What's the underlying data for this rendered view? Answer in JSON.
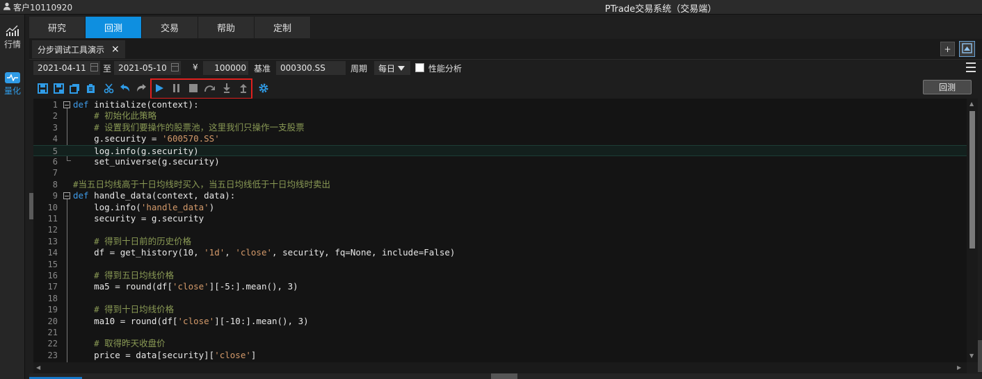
{
  "titlebar": {
    "user": "客户10110920",
    "title": "PTrade交易系统（交易端）"
  },
  "sidebar": {
    "items": [
      {
        "label": "行情",
        "icon": "market-chart-icon"
      },
      {
        "label": "量化",
        "icon": "quant-pulse-icon"
      }
    ]
  },
  "main_tabs": [
    "研究",
    "回测",
    "交易",
    "帮助",
    "定制"
  ],
  "active_main_tab": "回测",
  "file_tab": {
    "label": "分步调试工具演示",
    "close": "×"
  },
  "params": {
    "start_date": "2021-04-11",
    "to_label": "至",
    "end_date": "2021-05-10",
    "currency": "¥",
    "capital": "100000",
    "benchmark_label": "基准",
    "benchmark": "000300.SS",
    "period_label": "周期",
    "period": "每日",
    "perf_label": "性能分析"
  },
  "toolbar": {
    "backtest_label": "回测",
    "plus_label": "+"
  },
  "code_lines": [
    {
      "num": "1",
      "parts": [
        [
          "kw",
          "def"
        ],
        [
          "",
          "initialize(context):"
        ]
      ]
    },
    {
      "num": "2",
      "parts": [
        [
          "",
          "    "
        ],
        [
          "cm",
          "# 初始化此策略"
        ]
      ]
    },
    {
      "num": "3",
      "parts": [
        [
          "",
          "    "
        ],
        [
          "cm",
          "# 设置我们要操作的股票池，这里我们只操作一支股票"
        ]
      ]
    },
    {
      "num": "4",
      "parts": [
        [
          "",
          "    g.security = "
        ],
        [
          "st",
          "'600570.SS'"
        ]
      ]
    },
    {
      "num": "5",
      "parts": [
        [
          "",
          "    log.info(g.security)"
        ]
      ]
    },
    {
      "num": "6",
      "parts": [
        [
          "",
          "    set_universe(g.security)"
        ]
      ]
    },
    {
      "num": "7",
      "parts": []
    },
    {
      "num": "8",
      "parts": [
        [
          "cm",
          "#当五日均线高于十日均线时买入，当五日均线低于十日均线时卖出"
        ]
      ]
    },
    {
      "num": "9",
      "parts": [
        [
          "kw",
          "def"
        ],
        [
          "",
          "handle_data(context, data):"
        ]
      ]
    },
    {
      "num": "10",
      "parts": [
        [
          "",
          "    log.info("
        ],
        [
          "st",
          "'handle_data'"
        ],
        [
          "",
          ")"
        ]
      ]
    },
    {
      "num": "11",
      "parts": [
        [
          "",
          "    security = g.security"
        ]
      ]
    },
    {
      "num": "12",
      "parts": []
    },
    {
      "num": "13",
      "parts": [
        [
          "",
          "    "
        ],
        [
          "cm",
          "# 得到十日前的历史价格"
        ]
      ]
    },
    {
      "num": "14",
      "parts": [
        [
          "",
          "    df = get_history(10, "
        ],
        [
          "st",
          "'1d'"
        ],
        [
          "",
          ", "
        ],
        [
          "st",
          "'close'"
        ],
        [
          "",
          ", security, fq=None, include=False)"
        ]
      ]
    },
    {
      "num": "15",
      "parts": []
    },
    {
      "num": "16",
      "parts": [
        [
          "",
          "    "
        ],
        [
          "cm",
          "# 得到五日均线价格"
        ]
      ]
    },
    {
      "num": "17",
      "parts": [
        [
          "",
          "    ma5 = round(df["
        ],
        [
          "st",
          "'close'"
        ],
        [
          "",
          "][-5:].mean(), 3)"
        ]
      ]
    },
    {
      "num": "18",
      "parts": []
    },
    {
      "num": "19",
      "parts": [
        [
          "",
          "    "
        ],
        [
          "cm",
          "# 得到十日均线价格"
        ]
      ]
    },
    {
      "num": "20",
      "parts": [
        [
          "",
          "    ma10 = round(df["
        ],
        [
          "st",
          "'close'"
        ],
        [
          "",
          "][-10:].mean(), 3)"
        ]
      ]
    },
    {
      "num": "21",
      "parts": []
    },
    {
      "num": "22",
      "parts": [
        [
          "",
          "    "
        ],
        [
          "cm",
          "# 取得昨天收盘价"
        ]
      ]
    },
    {
      "num": "23",
      "parts": [
        [
          "",
          "    price = data[security]["
        ],
        [
          "st",
          "'close'"
        ],
        [
          "",
          "]"
        ]
      ]
    }
  ]
}
